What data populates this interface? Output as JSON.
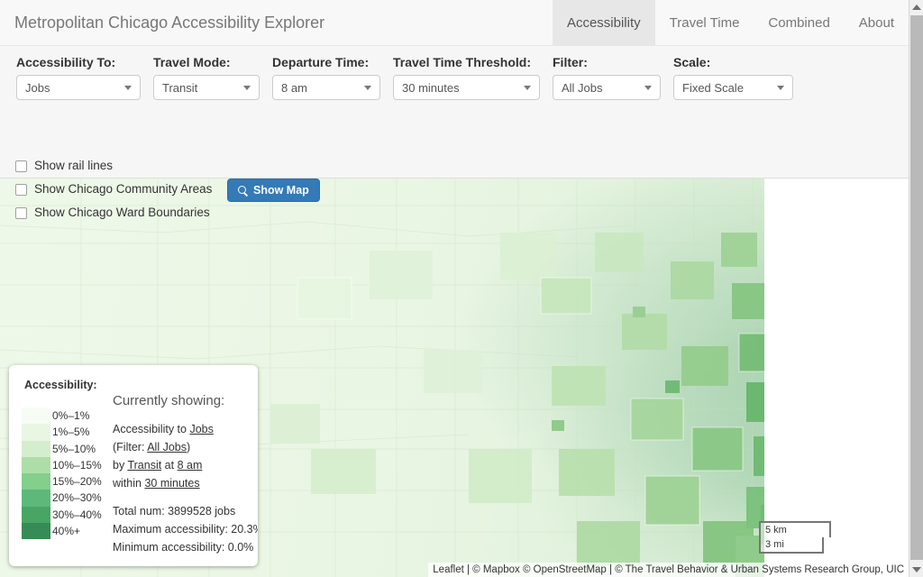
{
  "app": {
    "brand": "Metropolitan Chicago Accessibility Explorer"
  },
  "nav": {
    "tabs": [
      {
        "label": "Accessibility",
        "active": true
      },
      {
        "label": "Travel Time",
        "active": false
      },
      {
        "label": "Combined",
        "active": false
      },
      {
        "label": "About",
        "active": false
      }
    ]
  },
  "controls": {
    "selects": [
      {
        "label": "Accessibility To:",
        "value": "Jobs",
        "name": "accessibility-to"
      },
      {
        "label": "Travel Mode:",
        "value": "Transit",
        "name": "travel-mode"
      },
      {
        "label": "Departure Time:",
        "value": "8 am",
        "name": "departure-time"
      },
      {
        "label": "Travel Time Threshold:",
        "value": "30 minutes",
        "name": "travel-time-threshold"
      },
      {
        "label": "Filter:",
        "value": "All Jobs",
        "name": "filter"
      },
      {
        "label": "Scale:",
        "value": "Fixed Scale",
        "name": "scale"
      }
    ],
    "checkboxes": [
      {
        "label": "Show rail lines",
        "checked": false,
        "name": "show-rail-lines"
      },
      {
        "label": "Show Chicago Community Areas",
        "checked": false,
        "name": "show-community-areas"
      },
      {
        "label": "Show Chicago Ward Boundaries",
        "checked": false,
        "name": "show-ward-boundaries"
      }
    ],
    "show_map_button": "Show Map"
  },
  "legend": {
    "title": "Accessibility:",
    "bins": [
      {
        "label": "0%–1%",
        "color": "#f7fcf5"
      },
      {
        "label": "1%–5%",
        "color": "#e8f6e3"
      },
      {
        "label": "5%–10%",
        "color": "#d3eecd"
      },
      {
        "label": "10%–15%",
        "color": "#addea7"
      },
      {
        "label": "15%–20%",
        "color": "#7fcdbb"
      },
      {
        "label": "20%–30%",
        "color": "#5cb97a"
      },
      {
        "label": "30%–40%",
        "color": "#48a563"
      },
      {
        "label": "40%+",
        "color": "#378b55"
      }
    ],
    "showing_heading": "Currently showing:",
    "showing": {
      "line1_prefix": "Accessibility to ",
      "line1_value": "Jobs",
      "line2_prefix": "(Filter: ",
      "line2_value": "All Jobs",
      "line2_suffix": ")",
      "line3_prefix": "by ",
      "line3_value_a": "Transit",
      "line3_mid": " at ",
      "line3_value_b": "8 am",
      "line4_prefix": "within ",
      "line4_value": "30 minutes"
    },
    "stats": [
      "Total num: 3899528 jobs",
      "Maximum accessibility: 20.3%",
      "Minimum accessibility: 0.0%"
    ]
  },
  "map": {
    "scalebar": {
      "metric": "5 km",
      "imperial": "3 mi"
    },
    "attribution": "Leaflet | © Mapbox © OpenStreetMap | © The Travel Behavior & Urban Systems Research Group, UIC"
  },
  "colors": {
    "accent": "#337ab7",
    "navbar_bg": "#f8f8f8",
    "active_tab_bg": "#e7e7e7",
    "panel_bg": "#f6f6f6",
    "lake": "#ffffff"
  },
  "chart_data": {
    "type": "heatmap",
    "title": "Accessibility to Jobs by Transit at 8 am within 30 minutes",
    "legend_position": "bottom-left",
    "categories": [
      "0%–1%",
      "1%–5%",
      "5%–10%",
      "10%–15%",
      "15%–20%",
      "20%–30%",
      "30%–40%",
      "40%+"
    ],
    "colors": [
      "#f7fcf5",
      "#e8f6e3",
      "#d3eecd",
      "#addea7",
      "#7fcdbb",
      "#5cb97a",
      "#48a563",
      "#378b55"
    ],
    "summary": {
      "total_jobs": 3899528,
      "max_accessibility_pct": 20.3,
      "min_accessibility_pct": 0.0
    }
  }
}
